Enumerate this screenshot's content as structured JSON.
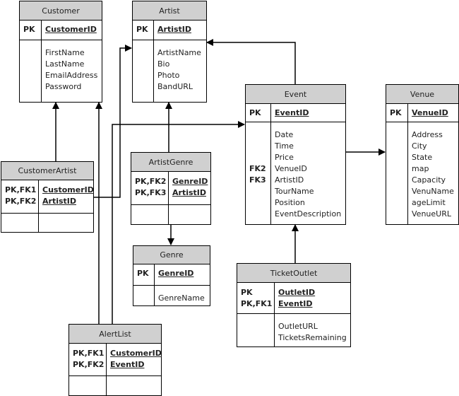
{
  "entities": [
    {
      "name": "Customer",
      "keys": [
        {
          "k": "PK",
          "f": "CustomerID"
        }
      ],
      "attrs": [
        {
          "k": "",
          "f": "FirstName"
        },
        {
          "k": "",
          "f": "LastName"
        },
        {
          "k": "",
          "f": "EmailAddress"
        },
        {
          "k": "",
          "f": "Password"
        }
      ]
    },
    {
      "name": "Artist",
      "keys": [
        {
          "k": "PK",
          "f": "ArtistID"
        }
      ],
      "attrs": [
        {
          "k": "",
          "f": "ArtistName"
        },
        {
          "k": "",
          "f": "Bio"
        },
        {
          "k": "",
          "f": "Photo"
        },
        {
          "k": "",
          "f": "BandURL"
        }
      ]
    },
    {
      "name": "Event",
      "keys": [
        {
          "k": "PK",
          "f": "EventID"
        }
      ],
      "attrs": [
        {
          "k": "",
          "f": "Date"
        },
        {
          "k": "",
          "f": "Time"
        },
        {
          "k": "",
          "f": "Price"
        },
        {
          "k": "FK2",
          "f": "VenueID"
        },
        {
          "k": "FK3",
          "f": "ArtistID"
        },
        {
          "k": "",
          "f": "TourName"
        },
        {
          "k": "",
          "f": "Position"
        },
        {
          "k": "",
          "f": "EventDescription"
        }
      ]
    },
    {
      "name": "Venue",
      "keys": [
        {
          "k": "PK",
          "f": "VenueID"
        }
      ],
      "attrs": [
        {
          "k": "",
          "f": "Address"
        },
        {
          "k": "",
          "f": "City"
        },
        {
          "k": "",
          "f": "State"
        },
        {
          "k": "",
          "f": "map"
        },
        {
          "k": "",
          "f": "Capacity"
        },
        {
          "k": "",
          "f": "VenuName"
        },
        {
          "k": "",
          "f": "ageLimit"
        },
        {
          "k": "",
          "f": "VenueURL"
        }
      ]
    },
    {
      "name": "CustomerArtist",
      "keys": [
        {
          "k": "PK,FK1",
          "f": "CustomerID"
        },
        {
          "k": "PK,FK2",
          "f": "ArtistID"
        }
      ],
      "attrs": []
    },
    {
      "name": "ArtistGenre",
      "keys": [
        {
          "k": "PK,FK2",
          "f": "GenreID"
        },
        {
          "k": "PK,FK3",
          "f": "ArtistID"
        }
      ],
      "attrs": []
    },
    {
      "name": "Genre",
      "keys": [
        {
          "k": "PK",
          "f": "GenreID"
        }
      ],
      "attrs": [
        {
          "k": "",
          "f": "GenreName"
        }
      ]
    },
    {
      "name": "TicketOutlet",
      "keys": [
        {
          "k": "PK",
          "f": "OutletID"
        },
        {
          "k": "PK,FK1",
          "f": "EventID"
        }
      ],
      "attrs": [
        {
          "k": "",
          "f": "OutletURL"
        },
        {
          "k": "",
          "f": "TicketsRemaining"
        }
      ]
    },
    {
      "name": "AlertList",
      "keys": [
        {
          "k": "PK,FK1",
          "f": "CustomerID"
        },
        {
          "k": "PK,FK2",
          "f": "EventID"
        }
      ],
      "attrs": []
    }
  ],
  "relationships": [
    {
      "from": "CustomerArtist",
      "to": "Customer"
    },
    {
      "from": "CustomerArtist",
      "to": "Artist"
    },
    {
      "from": "AlertList",
      "to": "Customer"
    },
    {
      "from": "AlertList",
      "to": "Event"
    },
    {
      "from": "ArtistGenre",
      "to": "Artist"
    },
    {
      "from": "ArtistGenre",
      "to": "Genre"
    },
    {
      "from": "Event",
      "to": "Artist"
    },
    {
      "from": "Event",
      "to": "Venue"
    },
    {
      "from": "TicketOutlet",
      "to": "Event"
    }
  ]
}
